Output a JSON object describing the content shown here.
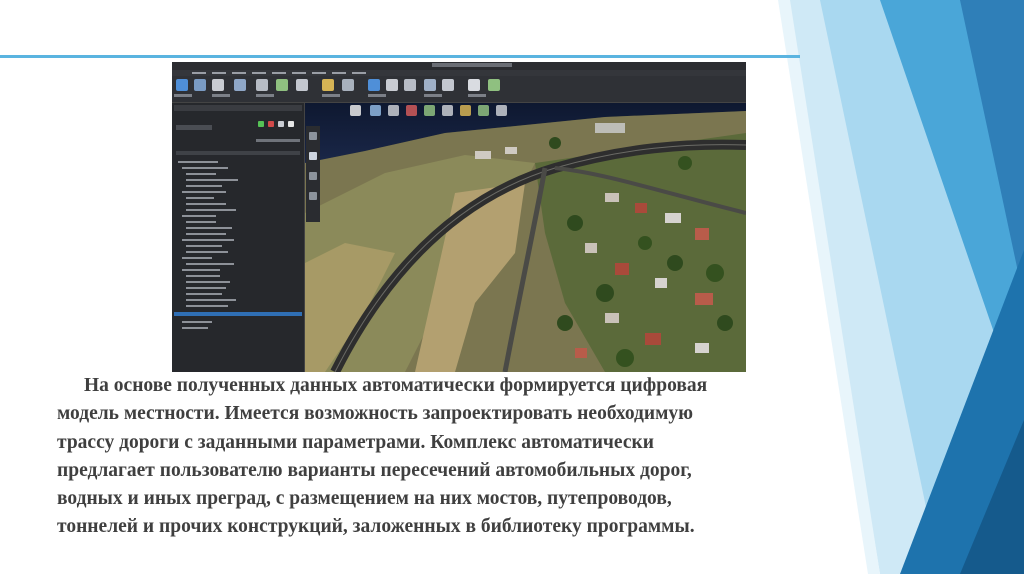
{
  "slide": {
    "accent_color": "#5ab4e0",
    "caption_lines": [
      "На основе полученных данных автоматически формируется цифровая",
      "модель местности. Имеется возможность запроектировать необходимую",
      "трассу дороги с заданными параметрами. Комплекс автоматически",
      "предлагает пользователю варианты пересечений автомобильных дорог,",
      "водных и иных преград, с размещением на них мостов, путепроводов,",
      "тоннелей и прочих конструкций, заложенных в библиотеку программы."
    ]
  },
  "screenshot": {
    "description_icon": "aerial-map-image"
  }
}
